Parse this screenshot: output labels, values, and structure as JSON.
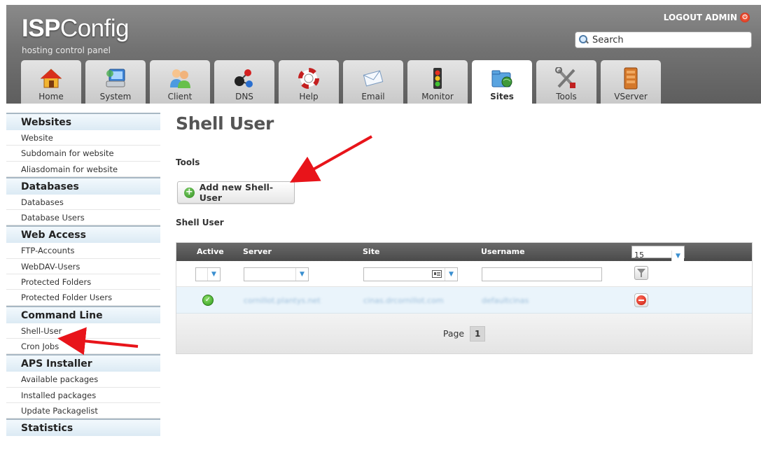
{
  "header": {
    "logo_prefix": "ISP",
    "logo_suffix": "Config",
    "tagline": "hosting control panel",
    "logout_label": "LOGOUT ADMIN",
    "search_placeholder": "Search"
  },
  "tabs": [
    {
      "label": "Home",
      "icon": "home-icon"
    },
    {
      "label": "System",
      "icon": "system-icon"
    },
    {
      "label": "Client",
      "icon": "client-icon"
    },
    {
      "label": "DNS",
      "icon": "dns-icon"
    },
    {
      "label": "Help",
      "icon": "help-icon"
    },
    {
      "label": "Email",
      "icon": "email-icon"
    },
    {
      "label": "Monitor",
      "icon": "monitor-icon"
    },
    {
      "label": "Sites",
      "icon": "sites-icon",
      "active": true
    },
    {
      "label": "Tools",
      "icon": "tools-icon"
    },
    {
      "label": "VServer",
      "icon": "vserver-icon"
    }
  ],
  "sidebar": {
    "sections": [
      {
        "title": "Websites",
        "items": [
          "Website",
          "Subdomain for website",
          "Aliasdomain for website"
        ]
      },
      {
        "title": "Databases",
        "items": [
          "Databases",
          "Database Users"
        ]
      },
      {
        "title": "Web Access",
        "items": [
          "FTP-Accounts",
          "WebDAV-Users",
          "Protected Folders",
          "Protected Folder Users"
        ]
      },
      {
        "title": "Command Line",
        "items": [
          "Shell-User",
          "Cron Jobs"
        ]
      },
      {
        "title": "APS Installer",
        "items": [
          "Available packages",
          "Installed packages",
          "Update Packagelist"
        ]
      },
      {
        "title": "Statistics",
        "items": []
      }
    ]
  },
  "main": {
    "title": "Shell User",
    "tools_label": "Tools",
    "add_button_label": "Add new Shell-User",
    "list_label": "Shell User",
    "table": {
      "columns": [
        "Active",
        "Server",
        "Site",
        "Username"
      ],
      "per_page": "15",
      "rows": [
        {
          "active": true,
          "server": "cornillot.plantys.net",
          "site": "cinas.drcornillot.com",
          "username": "defaultcinas"
        }
      ]
    },
    "pager": {
      "label": "Page",
      "current": "1"
    }
  },
  "colors": {
    "header_gray": "#727272",
    "sidebar_head": "#dceaf4",
    "row_highlight": "#eaf4fb",
    "annotation_arrow": "#e8141a"
  }
}
